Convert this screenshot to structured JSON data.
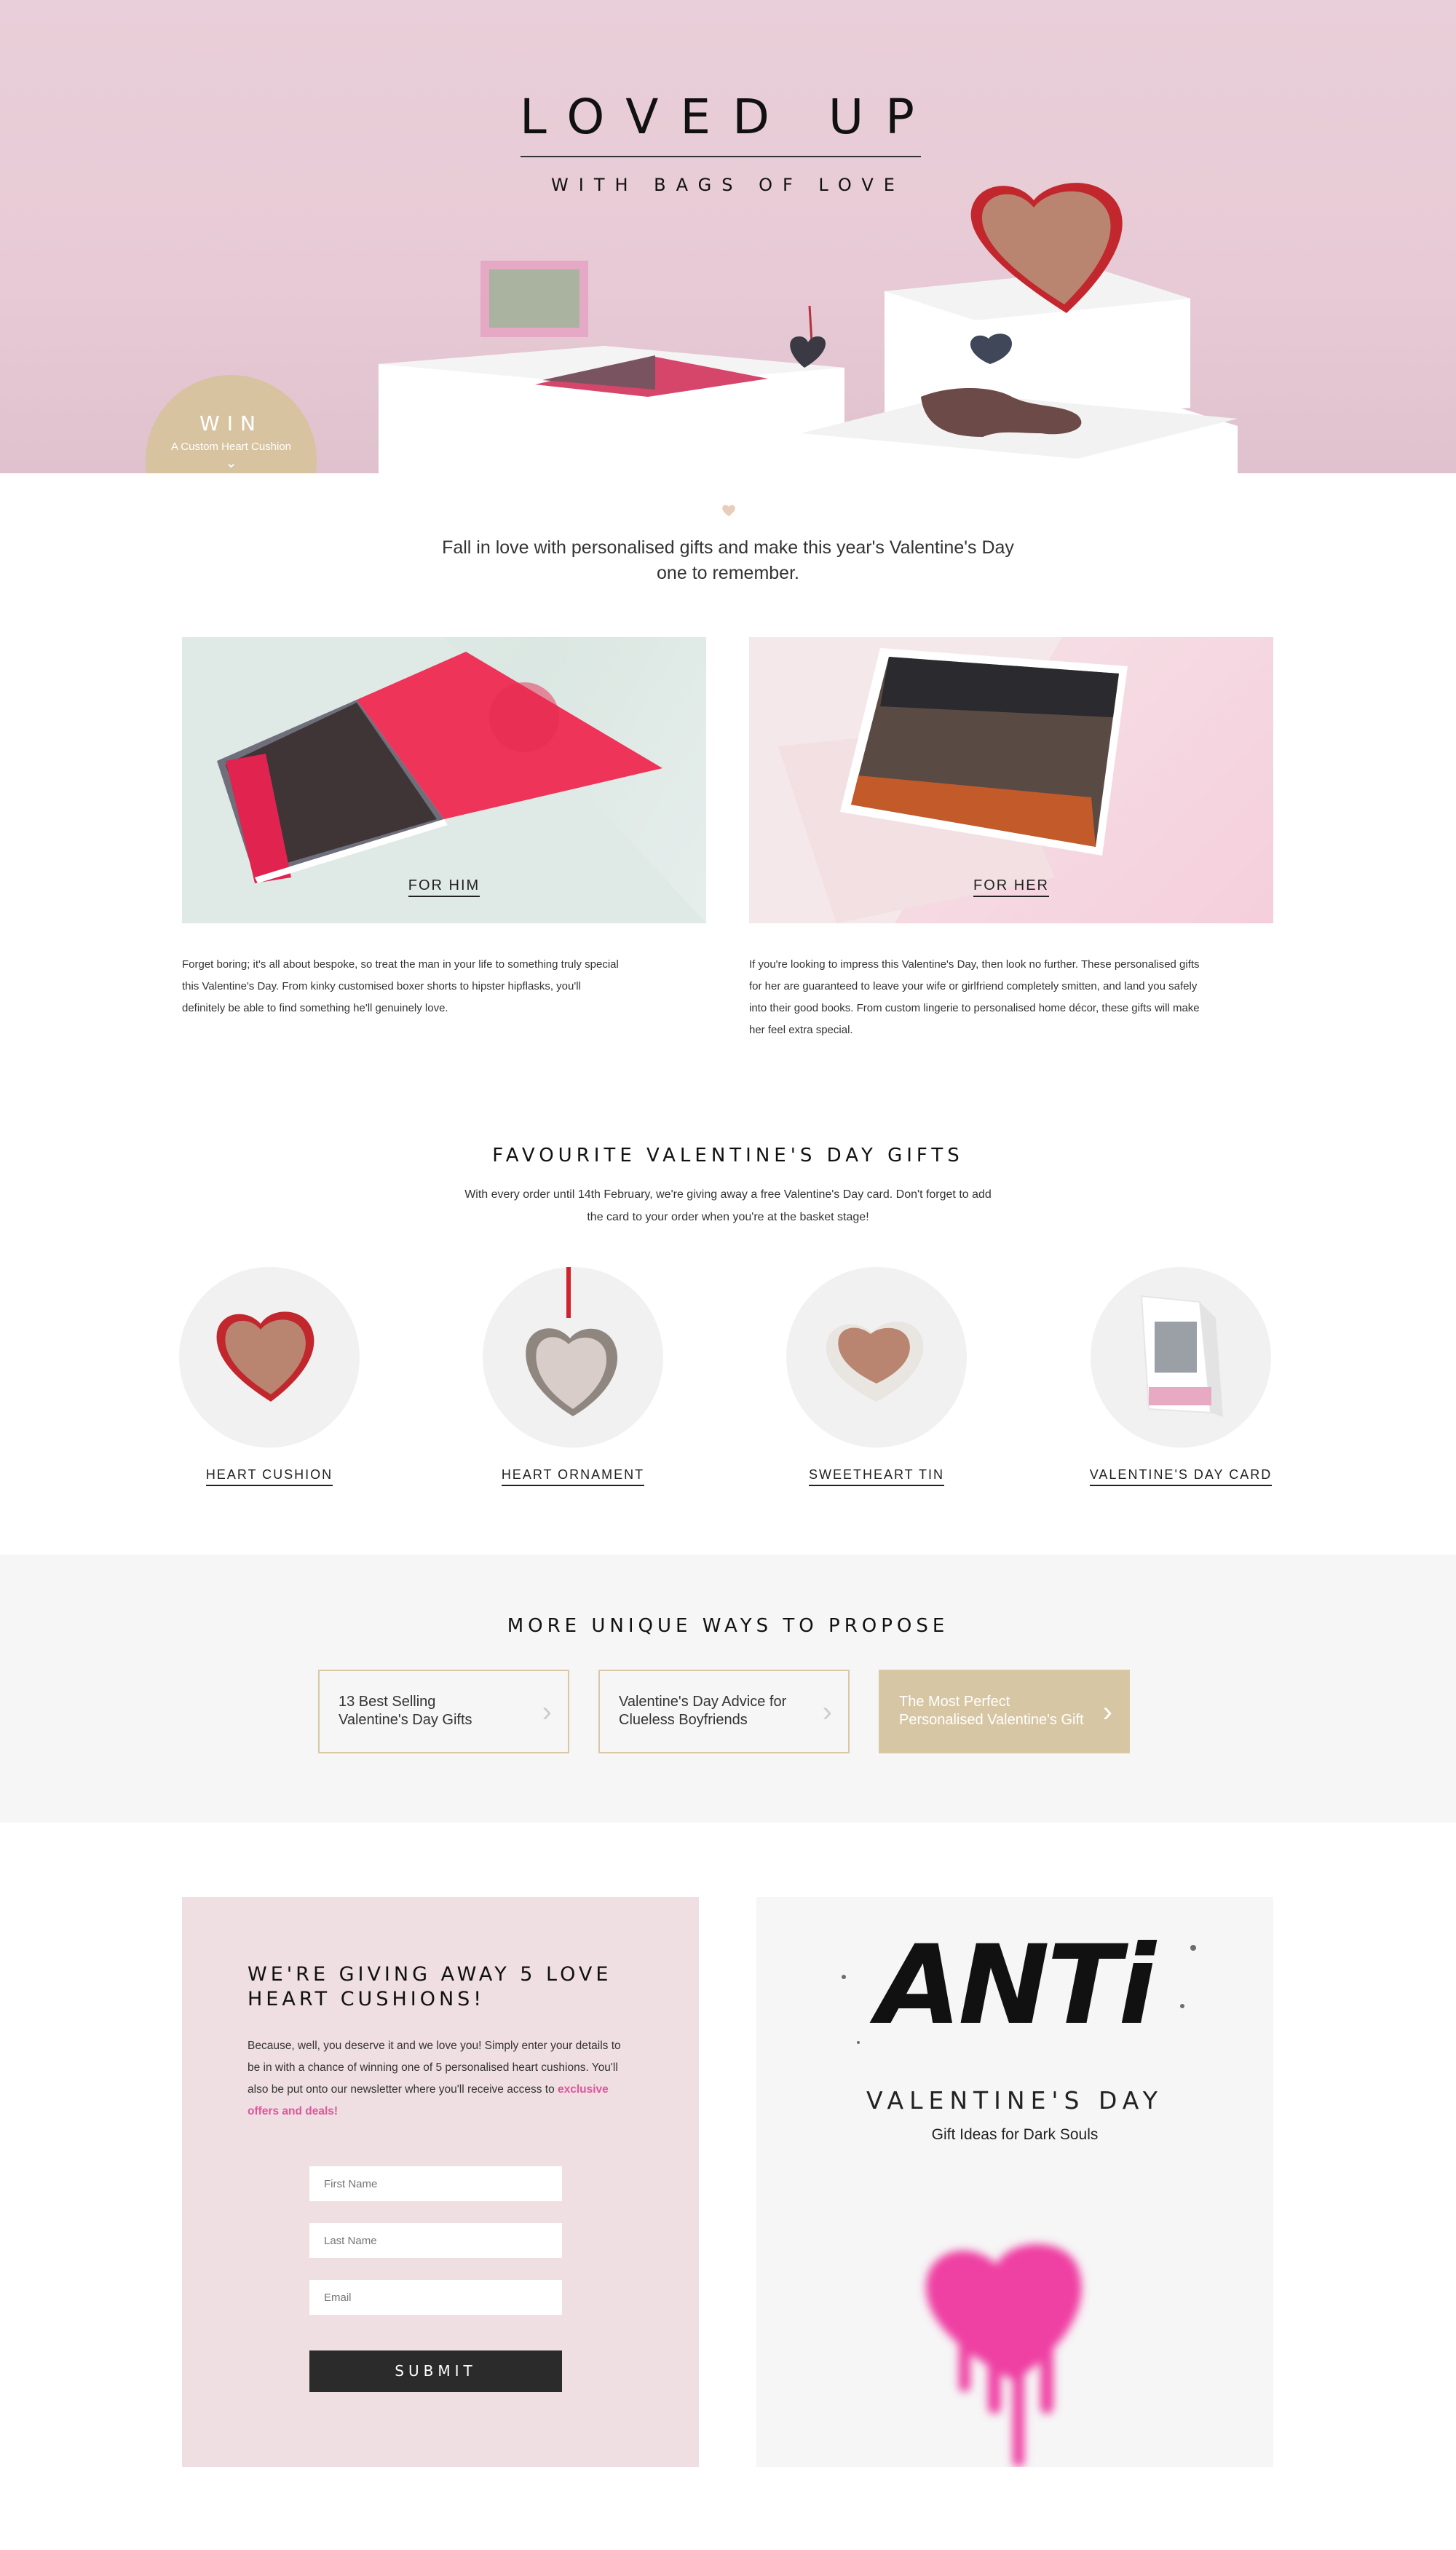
{
  "hero": {
    "title": "LOVED UP",
    "subtitle": "WITH BAGS OF LOVE",
    "win_title": "WIN",
    "win_subtitle": "A Custom Heart Cushion",
    "win_chevron": "⌄"
  },
  "intro": {
    "text": "Fall in love with personalised gifts and make this year's Valentine's Day one to remember."
  },
  "panels": {
    "him": {
      "label": "FOR HIM",
      "description": "Forget boring; it's all about bespoke, so treat the man in your life to something truly special this Valentine's Day. From kinky customised boxer shorts to hipster hipflasks, you'll definitely be able to find something he'll genuinely love."
    },
    "her": {
      "label": "FOR HER",
      "description": "If you're looking to impress this Valentine's Day, then look no further. These personalised gifts for her are guaranteed to leave your wife or girlfriend completely smitten, and land you safely into their good books. From custom lingerie to personalised home décor, these gifts will make her feel extra special."
    }
  },
  "favourites": {
    "title": "FAVOURITE VALENTINE'S DAY GIFTS",
    "text": "With every order until 14th February, we're giving away a free Valentine's Day card. Don't forget to add the card to your order when you're at the basket stage!",
    "items": [
      {
        "label": "HEART CUSHION"
      },
      {
        "label": "HEART ORNAMENT"
      },
      {
        "label": "SWEETHEART TIN"
      },
      {
        "label": "VALENTINE'S DAY CARD"
      }
    ]
  },
  "propose": {
    "title": "MORE UNIQUE WAYS TO PROPOSE",
    "links": [
      {
        "line1": "13 Best Selling",
        "line2": "Valentine's Day Gifts"
      },
      {
        "line1": "Valentine's Day Advice for",
        "line2": "Clueless Boyfriends"
      },
      {
        "line1": "The Most Perfect",
        "line2": "Personalised Valentine's Gift"
      }
    ],
    "chevron": "›"
  },
  "competition": {
    "title": "WE'RE GIVING AWAY 5 LOVE HEART CUSHIONS!",
    "text": "Because, well, you deserve it and we love you! Simply enter your details to be in with a chance of winning one of 5 personalised heart cushions. You'll also be put onto our newsletter where you'll receive access to",
    "link": "exclusive offers and deals!",
    "first_name_placeholder": "First Name",
    "last_name_placeholder": "Last Name",
    "email_placeholder": "Email",
    "submit": "SUBMIT"
  },
  "anti": {
    "word": "ANTi",
    "title": "VALENTINE'S DAY",
    "subtitle": "Gift Ideas for Dark Souls"
  },
  "colors": {
    "hero_bg": "#e8ccd7",
    "gold": "#d7c6a3",
    "pink_link": "#e0559b",
    "comp_bg": "#efdfe2",
    "heart_pink": "#ef3fa3"
  }
}
